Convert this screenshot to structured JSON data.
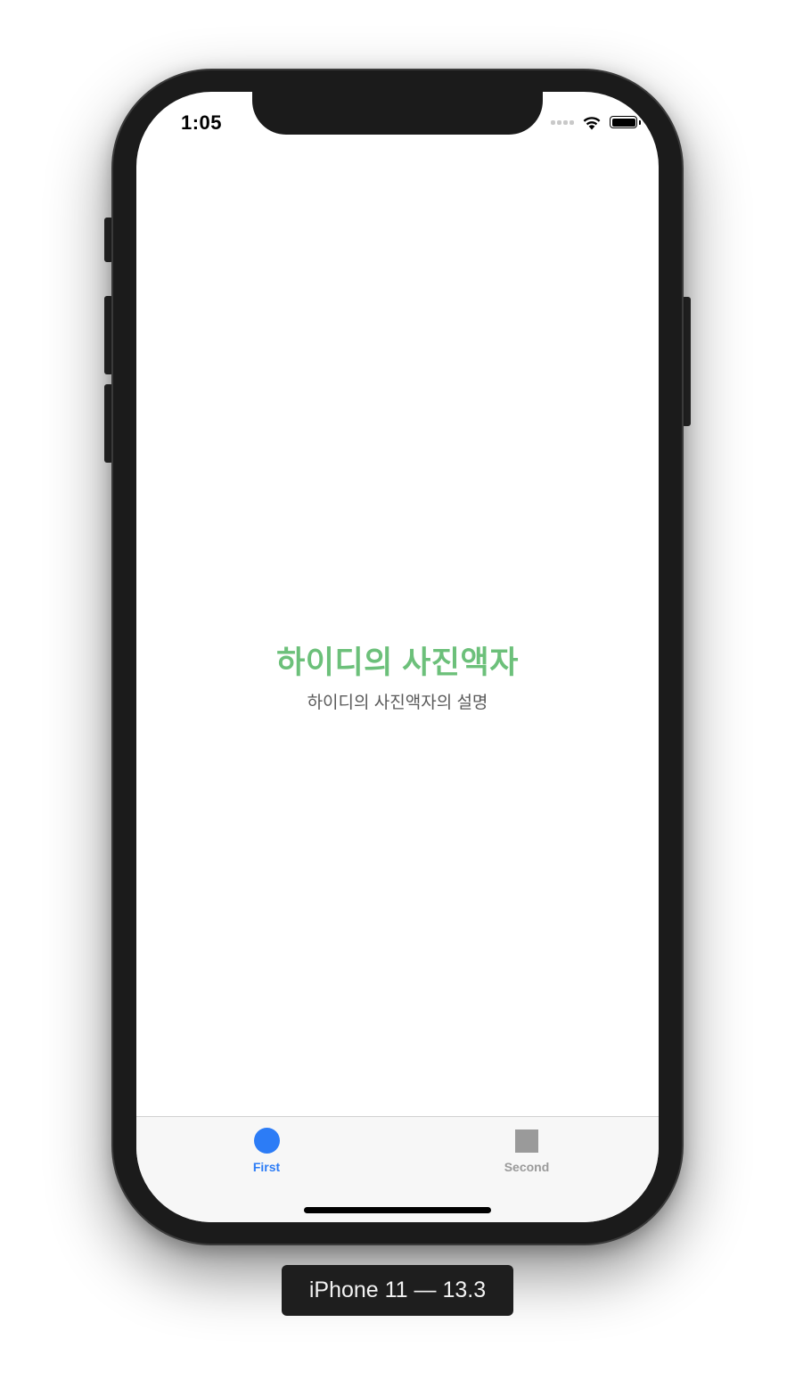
{
  "status_bar": {
    "time": "1:05",
    "icons": [
      "cellular-signal-icon",
      "wifi-icon",
      "battery-icon"
    ]
  },
  "main": {
    "title": "하이디의 사진액자",
    "subtitle": "하이디의 사진액자의 설명"
  },
  "tab_bar": {
    "items": [
      {
        "label": "First",
        "icon": "circle-icon",
        "selected": true
      },
      {
        "label": "Second",
        "icon": "square-icon",
        "selected": false
      }
    ]
  },
  "device_caption": "iPhone 11 — 13.3",
  "colors": {
    "accent": "#2c7cf6",
    "title_green": "#6cc07a",
    "inactive_gray": "#9a9a9a",
    "device_body": "#1b1b1b"
  }
}
